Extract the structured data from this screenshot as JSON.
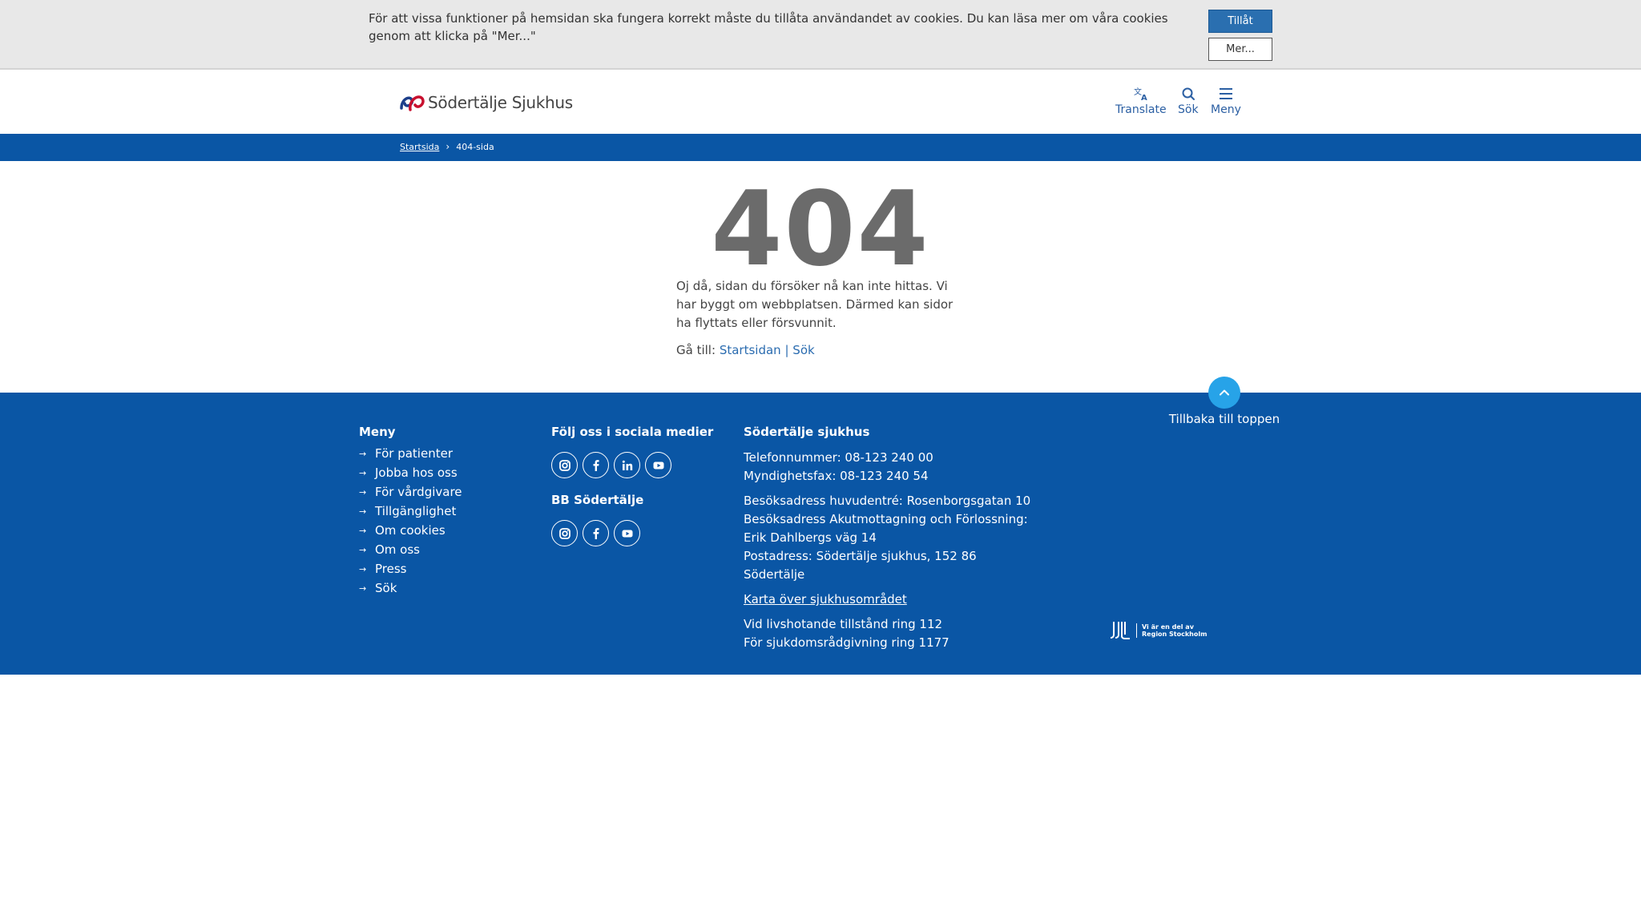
{
  "cookie": {
    "text": "För att vissa funktioner på hemsidan ska fungera korrekt måste du tillåta användandet av cookies. Du kan läsa mer om våra cookies genom att klicka på \"Mer...\"",
    "allow_label": "Tillåt",
    "more_label": "Mer..."
  },
  "header": {
    "logo_text": "Södertälje Sjukhus",
    "translate_label": "Translate",
    "search_label": "Sök",
    "menu_label": "Meny"
  },
  "breadcrumb": {
    "home": "Startsida",
    "current": "404-sida"
  },
  "main": {
    "code": "404",
    "message": "Oj då, sidan du försöker nå kan inte hittas. Vi har byggt om webbplatsen. Därmed kan sidor ha flyttats eller försvunnit.",
    "goto_label": "Gå till:",
    "goto_home": "Startsidan",
    "goto_sep": "|",
    "goto_search": "Sök"
  },
  "footer": {
    "to_top_label": "Tillbaka till toppen",
    "menu_heading": "Meny",
    "menu_items": [
      "För patienter",
      "Jobba hos oss",
      "För vårdgivare",
      "Tillgänglighet",
      "Om cookies",
      "Om oss",
      "Press",
      "Sök"
    ],
    "social_heading": "Följ oss i sociala medier",
    "social_icons": [
      "instagram-icon",
      "facebook-icon",
      "linkedin-icon",
      "youtube-icon"
    ],
    "bb_heading": "BB Södertälje",
    "bb_icons": [
      "instagram-icon",
      "facebook-icon",
      "youtube-icon"
    ],
    "contact_heading": "Södertälje sjukhus",
    "phone": "Telefonnummer: 08-123 240 00",
    "fax": "Myndighetsfax: 08-123 240 54",
    "visit_main": "Besöksadress huvudentré: Rosenborgsgatan 10",
    "visit_emergency": "Besöksadress Akutmottagning och Förlossning: Erik Dahlbergs väg 14",
    "postal": "Postadress: Södertälje sjukhus, 152 86 Södertälje",
    "map_link": "Karta över sjukhusområdet",
    "emergency": "Vid livshotande tillstånd ring 112",
    "advice": "För sjukdomsrådgivning ring 1177",
    "region_line1": "Vi är en del av",
    "region_line2": "Region Stockholm"
  },
  "colors": {
    "primary_blue": "#0a56a5",
    "button_blue": "#2a6fb0",
    "to_top": "#27a3e8",
    "link": "#2b6cb0"
  }
}
